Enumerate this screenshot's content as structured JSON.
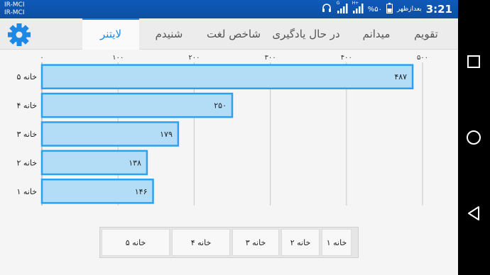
{
  "status_bar": {
    "carrier_1": "IR-MCI",
    "carrier_2": "IR-MCI",
    "time": "3:21",
    "ampm": "بعدازظهر",
    "battery": "%۵۰",
    "network_label": "G",
    "network_label_2": "H+",
    "icons": [
      "headset-icon",
      "signal-icon",
      "signal-icon",
      "battery-icon"
    ]
  },
  "tabs": [
    {
      "label": "تقویم",
      "active": false
    },
    {
      "label": "میدانم",
      "active": false
    },
    {
      "label": "در حال یادگیری",
      "active": false
    },
    {
      "label": "شاخص لغت",
      "active": false
    },
    {
      "label": "شنیدم",
      "active": false
    },
    {
      "label": "لایتنر",
      "active": true
    }
  ],
  "settings_icon": "gear-icon",
  "accent_color": "#1e88e5",
  "bar_fill": "#b3dcf7",
  "bar_border": "#29a3f0",
  "chart_data": {
    "type": "bar",
    "orientation": "horizontal",
    "categories": [
      "خانه ۵",
      "خانه ۴",
      "خانه ۳",
      "خانه ۲",
      "خانه ۱"
    ],
    "values": [
      487,
      250,
      179,
      138,
      146
    ],
    "value_labels": [
      "۴۸۷",
      "۲۵۰",
      "۱۷۹",
      "۱۳۸",
      "۱۴۶"
    ],
    "xticks": [
      0,
      100,
      200,
      300,
      400,
      500
    ],
    "xtick_labels": [
      "۰",
      "۱۰۰",
      "۲۰۰",
      "۳۰۰",
      "۴۰۰",
      "۵۰۰"
    ],
    "xlim": [
      0,
      500
    ],
    "grid": true,
    "title": "",
    "xlabel": "",
    "ylabel": ""
  },
  "box_buttons": [
    "خانه ۵",
    "خانه ۴",
    "خانه ۳",
    "خانه ۲",
    "خانه ۱"
  ],
  "nav": {
    "icons": [
      "recent-apps-icon",
      "home-icon",
      "back-icon"
    ]
  }
}
